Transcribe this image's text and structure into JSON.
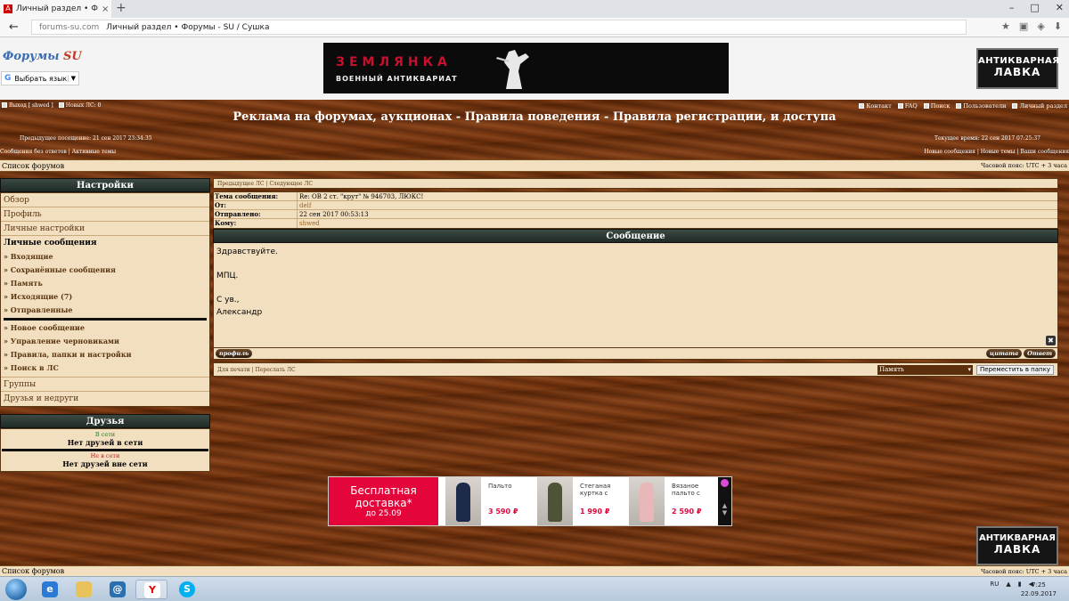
{
  "browser": {
    "tab_title": "Личный раздел • Форумы",
    "tab_close": "×",
    "new_tab": "+",
    "favicon": "A",
    "domain": "forums-su.com",
    "page_title": "Личный раздел • Форумы - SU / Сушка",
    "back": "←",
    "win_min": "–",
    "win_max": "□",
    "win_close": "✕"
  },
  "header": {
    "logo_main": "Форумы ",
    "logo_su": "SU",
    "translate_label": "Выбрать язык",
    "translate_g": "G",
    "translate_arrow": "▼",
    "banner_title": "ЗЕМЛЯНКА",
    "banner_subtitle": "ВОЕННЫЙ АНТИКВАРИАТ",
    "badge_line1": "АНТИКВАРНАЯ",
    "badge_line2": "ЛАВКА"
  },
  "topbar": {
    "logout": "Выход [ shwed ]",
    "new_pm": "Новых ЛС: 0",
    "contact": "Контакт",
    "faq": "FAQ",
    "search": "Поиск",
    "users": "Пользователи",
    "ucp": "Личный раздел"
  },
  "board": {
    "title": "Реклама на форумах, аукционах - Правила поведения - Правила регистрации, и доступа",
    "last_visit": "Предыдущее посещение: 21 сен 2017 23:34:35",
    "current_time": "Текущее время: 22 сен 2017 07:25:37",
    "links_left": "Сообщения без ответов  |  Активные темы",
    "links_right": "Новые сообщения  |  Новые темы  |  Ваши сообщения",
    "forum_list": "Список форумов",
    "timezone": "Часовой пояс: UTC + 3 часа"
  },
  "sidebar": {
    "settings_title": "Настройки",
    "overview": "Обзор",
    "profile": "Профиль",
    "personal_settings": "Личные настройки",
    "pm_title": "Личные сообщения",
    "inbox": "» Входящие",
    "saved": "» Сохранённые сообщения",
    "memory": "» Память",
    "outbox": "» Исходящие (7)",
    "sent": "» Отправленные",
    "new_msg": "» Новое сообщение",
    "drafts": "» Управление черновиками",
    "rules": "» Правила, папки и настройки",
    "search_pm": "» Поиск в ЛС",
    "groups": "Группы",
    "friends_foes": "Друзья и недруги",
    "friends_title": "Друзья",
    "online": "В сети",
    "no_online": "Нет друзей в сети",
    "offline": "Не в сети",
    "no_offline": "Нет друзей вне сети"
  },
  "message": {
    "nav": "Предыдущее ЛС  |  Следующее ЛС",
    "subject_label": "Тема сообщения:",
    "subject": "Re: ОВ 2 ст. \"крут\" № 946703, ЛЮКС!",
    "from_label": "От:",
    "from": "delf",
    "sent_label": "Отправлено:",
    "sent": "22 сен 2017 00:53:13",
    "to_label": "Кому:",
    "to": "shwed",
    "header": "Сообщение",
    "body": [
      "Здравствуйте.",
      "",
      "МПЦ.",
      "",
      "С ув.,",
      "Александр"
    ],
    "delete": "✖",
    "profile_btn": "профиль",
    "quote_btn": "цитата",
    "reply_btn": "Ответ",
    "print_links": "Для печати  |  Переслать ЛС",
    "folder_selected": "Память",
    "folder_arrow": "▾",
    "move_btn": "Переместить в папку"
  },
  "ad": {
    "l1": "Бесплатная",
    "l2": "доставка*",
    "l3": "до 25.09",
    "p1_name": "Пальто",
    "p1_price": "3 590 ₽",
    "p2_name": "Стеганая куртка с",
    "p2_price": "1 990 ₽",
    "p3_name": "Вязаное пальто с",
    "p3_price": "2 590 ₽",
    "up": "▲",
    "down": "▼"
  },
  "taskbar": {
    "lang": "RU",
    "time": "7:25",
    "date": "22.09.2017"
  },
  "colors": {
    "wood": "#6b3210",
    "panel": "#f2dfc0",
    "accent_red": "#c8102e",
    "ad_red": "#e4063a"
  }
}
